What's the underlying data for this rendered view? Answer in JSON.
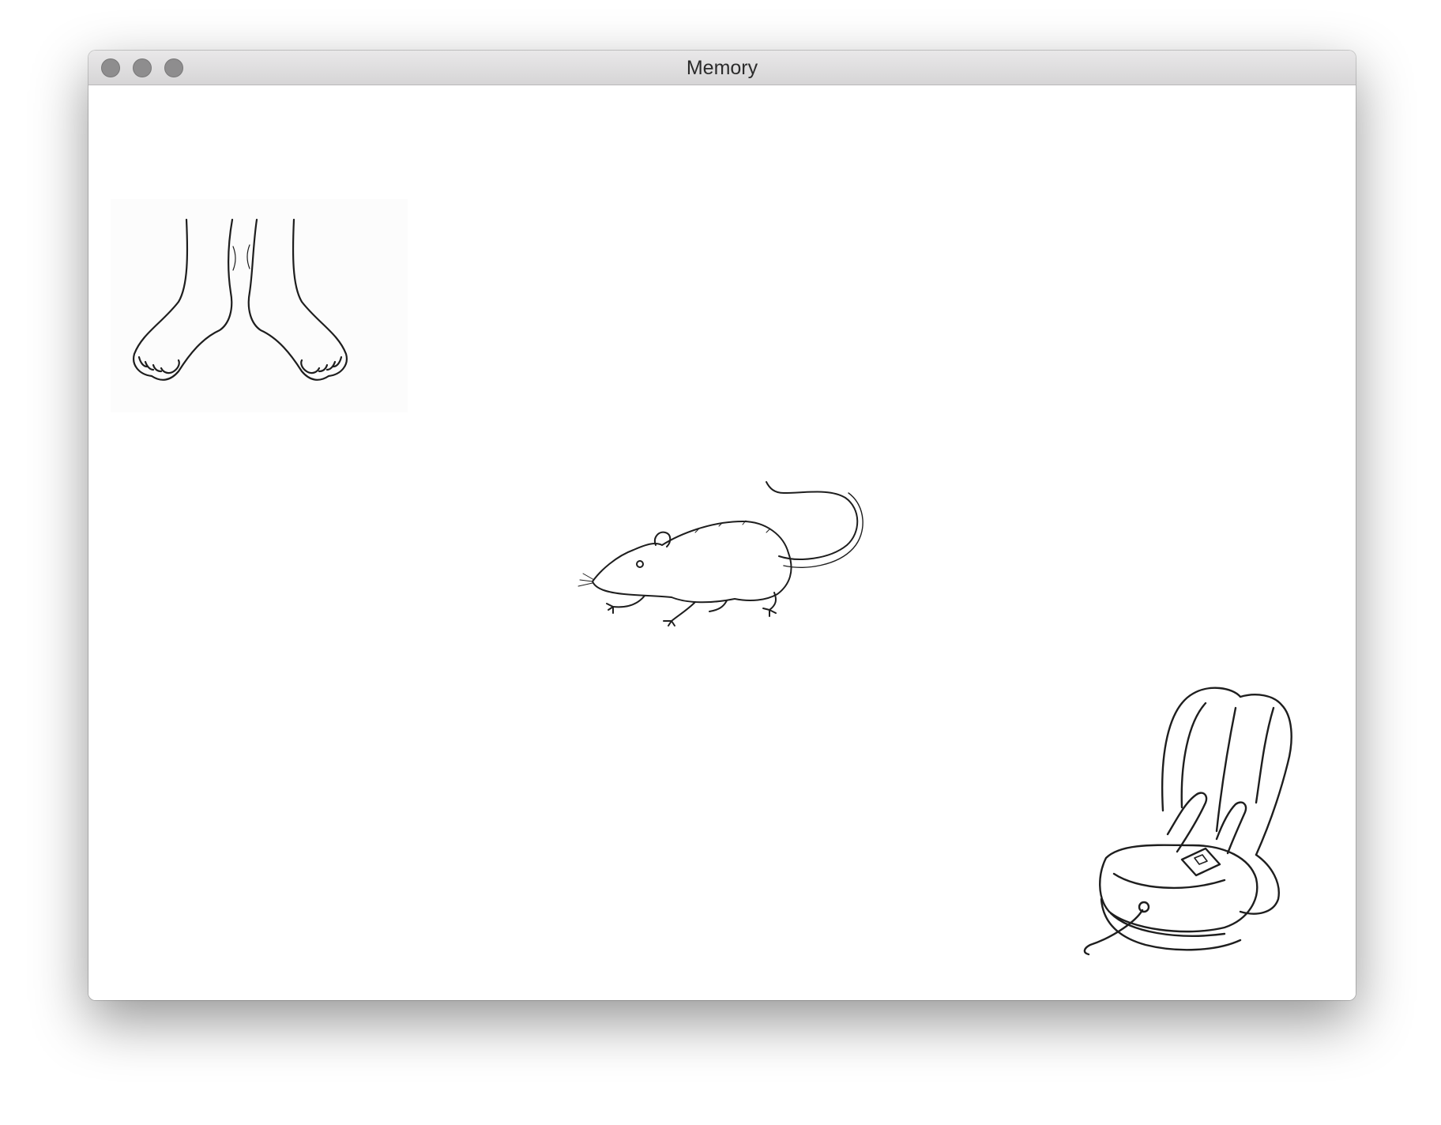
{
  "window": {
    "title": "Memory",
    "controls": [
      "close-icon",
      "minimize-icon",
      "zoom-icon"
    ]
  },
  "cards": [
    {
      "id": "feet",
      "icon": "feet-icon",
      "revealed": true
    },
    {
      "id": "rat",
      "icon": "rat-icon",
      "revealed": true
    },
    {
      "id": "car-seat",
      "icon": "baby-car-seat-icon",
      "revealed": true
    }
  ],
  "colors": {
    "titlebar": "#dedcde",
    "traffic_light": "#8e8d8e",
    "background": "#ffffff",
    "ink": "#1e1e1e"
  }
}
